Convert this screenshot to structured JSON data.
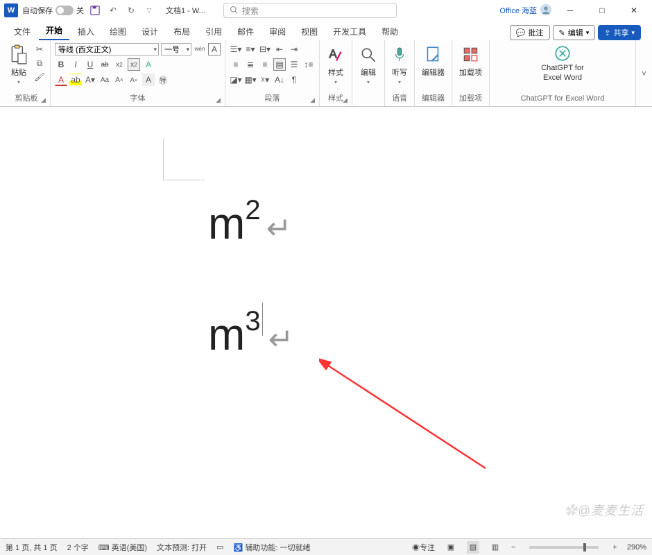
{
  "titlebar": {
    "autosave_label": "自动保存",
    "autosave_state": "关",
    "doc_title": "文档1 - W...",
    "search_placeholder": "搜索",
    "account": "Office 海蓝"
  },
  "tabs": {
    "items": [
      "文件",
      "开始",
      "插入",
      "绘图",
      "设计",
      "布局",
      "引用",
      "邮件",
      "审阅",
      "视图",
      "开发工具",
      "帮助"
    ],
    "active_index": 1,
    "comments": "批注",
    "editing": "编辑",
    "share": "共享"
  },
  "ribbon": {
    "clipboard": {
      "paste": "粘贴",
      "label": "剪贴板"
    },
    "font": {
      "font_name": "等线 (西文正文)",
      "font_size": "一号",
      "wen": "wén",
      "bold": "B",
      "italic": "I",
      "underline": "U",
      "strike": "ab",
      "x2": "x₂",
      "X2": "x²",
      "Aa": "Aa",
      "label": "字体"
    },
    "paragraph": {
      "label": "段落"
    },
    "styles": {
      "btn": "样式",
      "label": "样式"
    },
    "editing_grp": {
      "btn": "编辑",
      "label": ""
    },
    "dictate": {
      "btn": "听写",
      "label": "语音"
    },
    "editor": {
      "btn": "编辑器",
      "label": "编辑器"
    },
    "addins": {
      "btn": "加载项",
      "label": "加载项"
    },
    "chatgpt": {
      "line1": "ChatGPT for",
      "line2": "Excel Word",
      "label": "ChatGPT for Excel Word"
    }
  },
  "document": {
    "line1_base": "m",
    "line1_sup": "2",
    "line2_base": "m",
    "line2_sup": "3"
  },
  "statusbar": {
    "page": "第 1 页, 共 1 页",
    "words": "2 个字",
    "lang": "英语(美国)",
    "prediction": "文本预测: 打开",
    "a11y": "辅助功能: 一切就绪",
    "focus": "专注",
    "zoom": "290%"
  },
  "watermark": "@麦麦生活"
}
